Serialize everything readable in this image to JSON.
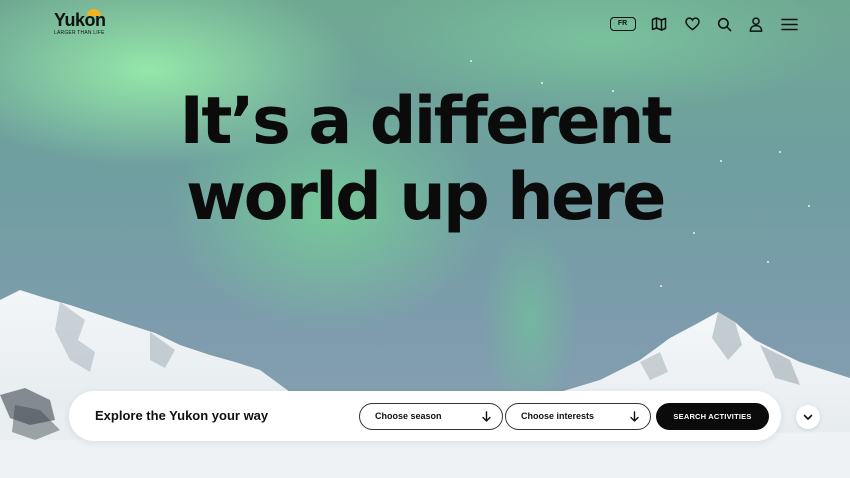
{
  "brand": {
    "name": "Yukon",
    "tagline": "LARGER THAN LIFE",
    "sun_color": "#f2b21f"
  },
  "nav": {
    "language_label": "FR",
    "icons": [
      "map-icon",
      "heart-icon",
      "search-icon",
      "user-icon",
      "menu-icon"
    ]
  },
  "hero": {
    "headline_line1": "It’s a different",
    "headline_line2": "world up here"
  },
  "search": {
    "title": "Explore the Yukon your way",
    "season_select": "Choose season",
    "interests_select": "Choose interests",
    "button_label": "SEARCH ACTIVITIES"
  },
  "colors": {
    "aurora_green": "#96ebaa",
    "sky": "#7e9cad",
    "text": "#0b0b0b",
    "button": "#0b0b0b"
  }
}
